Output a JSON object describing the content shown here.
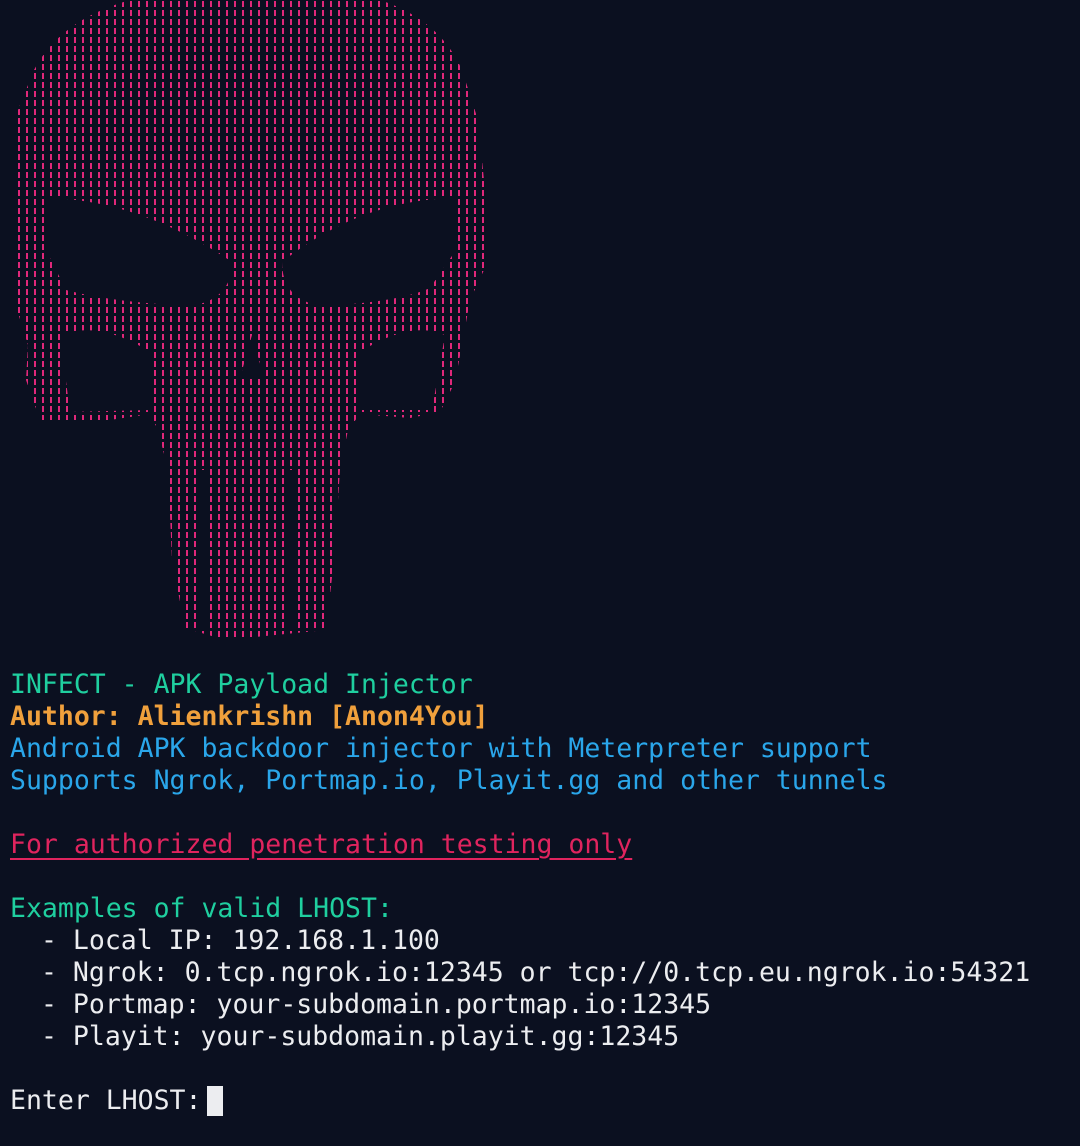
{
  "banner": {
    "art_icon": "punisher-skull-icon",
    "art_color": "#e0287a"
  },
  "header": {
    "title": "INFECT - APK Payload Injector",
    "author": "Author: Alienkrishn [Anon4You]",
    "description": "Android APK backdoor injector with Meterpreter support",
    "tunnels": "Supports Ngrok, Portmap.io, Playit.gg and other tunnels"
  },
  "warning": "For authorized penetration testing only",
  "examples": {
    "heading": "Examples of valid LHOST:",
    "items": [
      "- Local IP: 192.168.1.100",
      "- Ngrok: 0.tcp.ngrok.io:12345 or tcp://0.tcp.eu.ngrok.io:54321",
      "- Portmap: your-subdomain.portmap.io:12345",
      "- Playit: your-subdomain.playit.gg:12345"
    ]
  },
  "prompt": {
    "label": "Enter LHOST:",
    "value": ""
  },
  "colors": {
    "background": "#0b1020",
    "teal": "#1fcf9f",
    "gold": "#f0a03c",
    "blue": "#2aa6ea",
    "warning": "#e0245e",
    "text": "#ecedf0"
  }
}
